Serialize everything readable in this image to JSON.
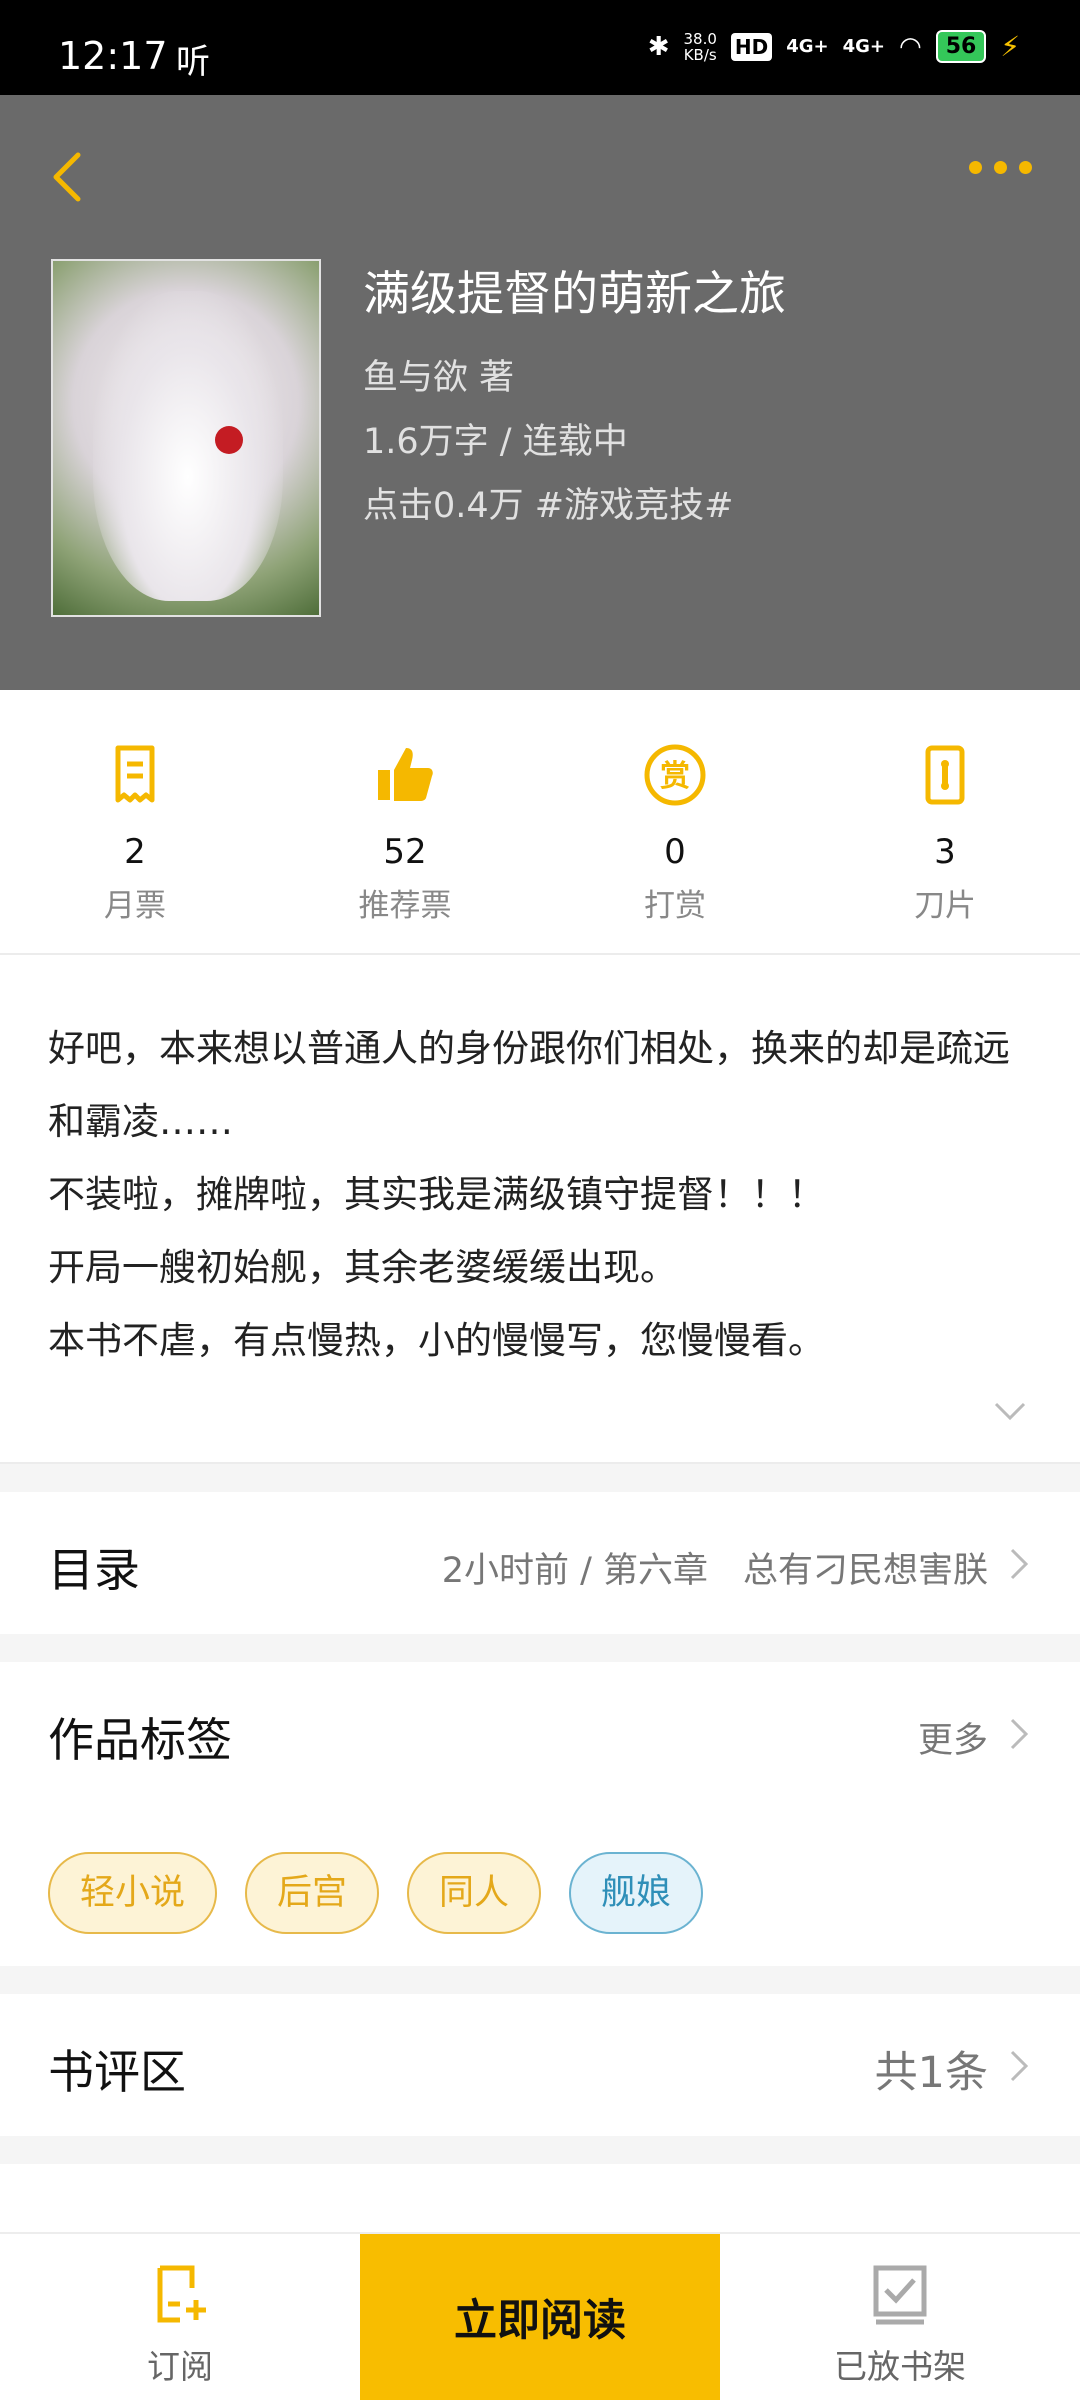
{
  "status_bar": {
    "time": "12:17",
    "listen": "听",
    "net_speed_value": "38.0",
    "net_speed_unit": "KB/s",
    "hd": "HD",
    "sig1": "4G+",
    "sig2": "4G+",
    "battery": "56"
  },
  "header": {
    "title": "满级提督的萌新之旅",
    "author": "鱼与欲  著",
    "words": "1.6万字 / 连载中",
    "clicks": "点击0.4万  #游戏竞技#"
  },
  "stats": [
    {
      "icon": "ticket-icon",
      "value": "2",
      "label": "月票"
    },
    {
      "icon": "thumbs-up-icon",
      "value": "52",
      "label": "推荐票"
    },
    {
      "icon": "reward-icon",
      "value": "0",
      "label": "打赏"
    },
    {
      "icon": "blade-icon",
      "value": "3",
      "label": "刀片"
    }
  ],
  "intro": {
    "lines": [
      "好吧，本来想以普通人的身份跟你们相处，换来的却是疏远和霸凌……",
      "不装啦，摊牌啦，其实我是满级镇守提督！！！",
      "开局一艘初始舰，其余老婆缓缓出现。",
      "本书不虐，有点慢热，小的慢慢写，您慢慢看。"
    ]
  },
  "catalog": {
    "title": "目录",
    "latest": "2小时前 / 第六章　总有刁民想害朕"
  },
  "tags": {
    "title": "作品标签",
    "more": "更多",
    "items": [
      {
        "label": "轻小说",
        "color": "yellow"
      },
      {
        "label": "后宫",
        "color": "yellow"
      },
      {
        "label": "同人",
        "color": "yellow"
      },
      {
        "label": "舰娘",
        "color": "blue"
      }
    ]
  },
  "reviews": {
    "title": "书评区",
    "count": "共1条"
  },
  "bottom_bar": {
    "subscribe": "订阅",
    "read_now": "立即阅读",
    "on_shelf": "已放书架"
  },
  "colors": {
    "accent": "#f8bd00",
    "header_bg": "#6a6a6a"
  }
}
